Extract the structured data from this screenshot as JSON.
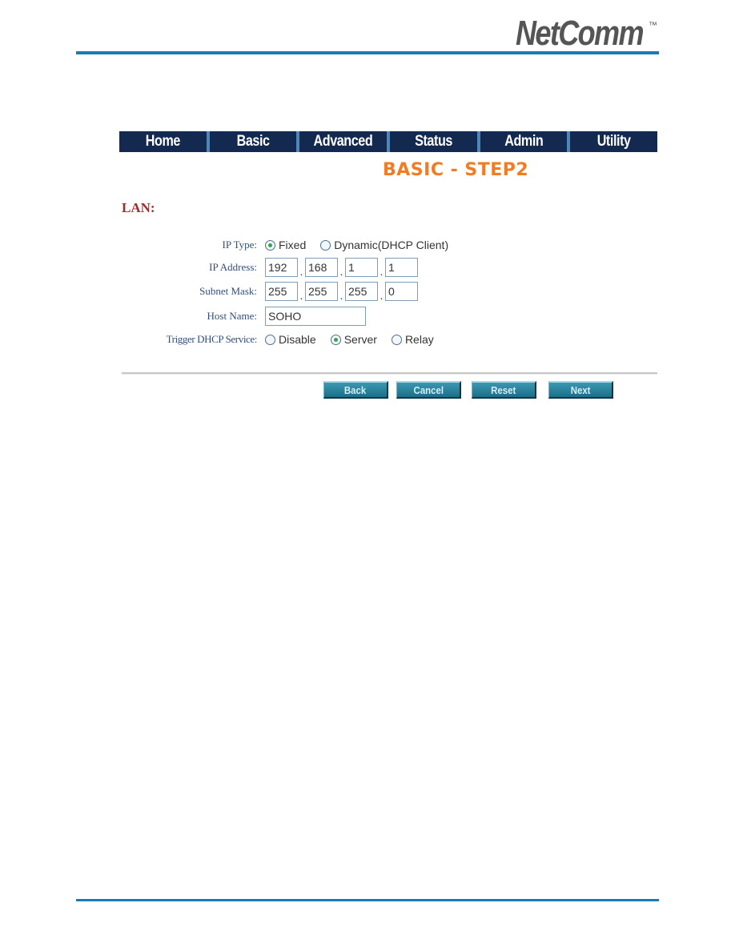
{
  "brand": {
    "logo_text": "NetComm",
    "trademark": "™",
    "accent_color": "#1a7ab5"
  },
  "nav": {
    "items": [
      {
        "label": "Home"
      },
      {
        "label": "Basic"
      },
      {
        "label": "Advanced"
      },
      {
        "label": "Status"
      },
      {
        "label": "Admin"
      },
      {
        "label": "Utility"
      }
    ]
  },
  "page": {
    "title": "BASIC - STEP2",
    "title_color": "#f27c22",
    "section": "LAN:"
  },
  "form": {
    "ip_type": {
      "label": "IP Type:",
      "options": [
        {
          "label": "Fixed",
          "checked": true
        },
        {
          "label": "Dynamic(DHCP Client)",
          "checked": false
        }
      ]
    },
    "ip_address": {
      "label": "IP Address:",
      "octets": [
        "192",
        "168",
        "1",
        "1"
      ],
      "separator": "."
    },
    "subnet_mask": {
      "label": "Subnet Mask:",
      "octets": [
        "255",
        "255",
        "255",
        "0"
      ],
      "separator": "."
    },
    "host_name": {
      "label": "Host Name:",
      "value": "SOHO"
    },
    "dhcp_service": {
      "label": "Trigger DHCP Service:",
      "options": [
        {
          "label": "Disable",
          "checked": false
        },
        {
          "label": "Server",
          "checked": true
        },
        {
          "label": "Relay",
          "checked": false
        }
      ]
    }
  },
  "buttons": {
    "back": "Back",
    "cancel": "Cancel",
    "reset": "Reset",
    "next": "Next"
  }
}
